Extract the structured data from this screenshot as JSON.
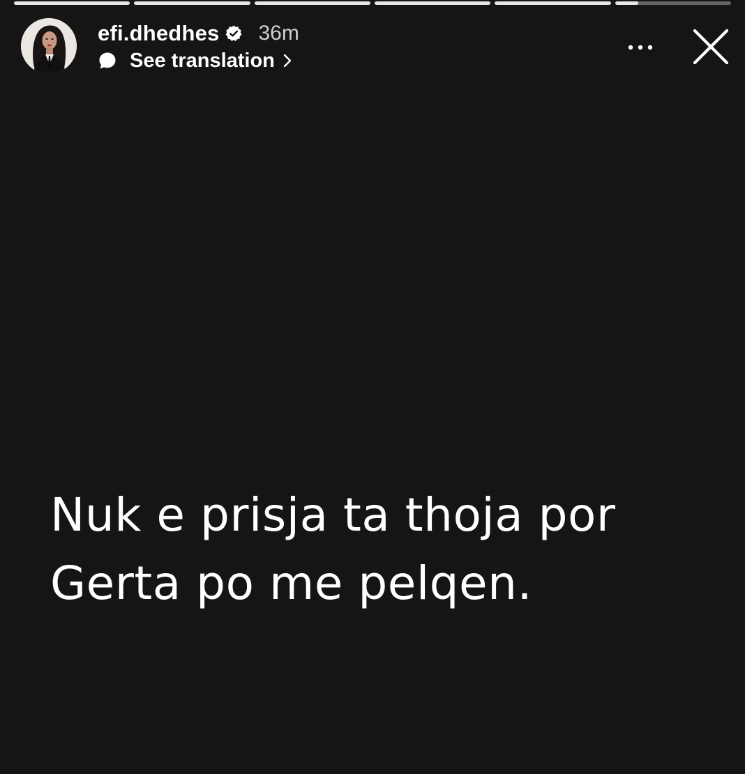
{
  "story": {
    "progress": [
      1,
      1,
      1,
      1,
      1,
      0.2
    ],
    "user": {
      "username": "efi.dhedhes",
      "verified": true,
      "time_ago": "36m"
    },
    "translation_label": "See translation",
    "icons": {
      "verified": "verified-badge-icon",
      "translate": "speech-bubble-icon",
      "chevron": "chevron-right-icon",
      "more": "more-horizontal-icon",
      "close": "close-icon"
    },
    "caption": {
      "lines": [
        "Nuk e prisja ta thoja por",
        "Gerta po me pelqen."
      ]
    }
  },
  "colors": {
    "background": "#151515",
    "text": "#ffffff",
    "progress_track": "rgba(255,255,255,0.35)",
    "progress_fill": "#e6e6e6"
  }
}
